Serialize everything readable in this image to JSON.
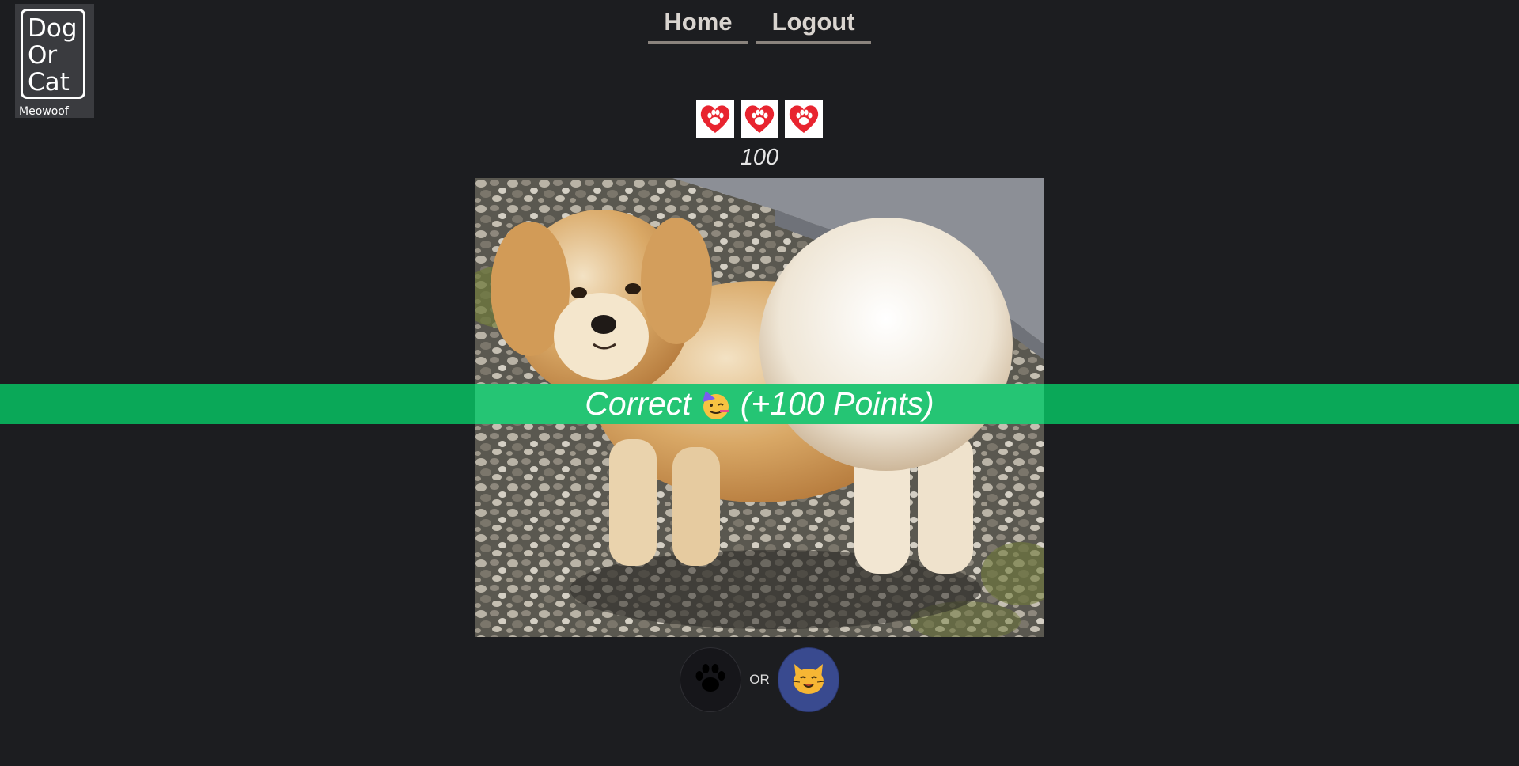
{
  "logo": {
    "lines": [
      "Dog",
      "Or",
      "Cat"
    ],
    "subtitle": "Meowoof"
  },
  "nav": {
    "home_label": "Home",
    "logout_label": "Logout"
  },
  "game": {
    "lives": 3,
    "life_icon": "paw-heart-icon",
    "score": "100",
    "result_text": "Correct",
    "result_points": "(+100 Points)",
    "result_icon": "party-face-icon",
    "choice_dog_icon": "paw-icon",
    "choice_or_label": "OR",
    "choice_cat_icon": "cat-face-icon"
  },
  "colors": {
    "background": "#1c1d20",
    "banner": "#0aa858",
    "heart": "#e8242f",
    "cat_button": "#394a8f"
  }
}
